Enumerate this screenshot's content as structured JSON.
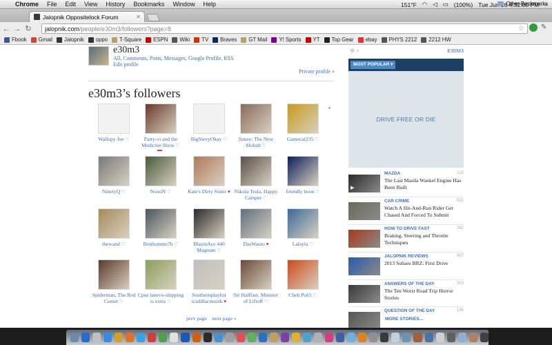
{
  "menubar": {
    "app": "Chrome",
    "items": [
      "File",
      "Edit",
      "View",
      "History",
      "Bookmarks",
      "Window",
      "Help"
    ],
    "temperature": "151°F",
    "battery": "(100%)",
    "clock": "Tue Jun 26  4:32:00 PM"
  },
  "tab": {
    "title": "Jalopnik Oppositelock Forum"
  },
  "address": {
    "host": "jalopnik.com",
    "path": "/people/e30m3/followers?page=8"
  },
  "bookmarks": {
    "items": [
      {
        "label": "Fbook",
        "color": "#3b5998"
      },
      {
        "label": "Gmail",
        "color": "#d14836"
      },
      {
        "label": "Jalopnik",
        "color": "#333333"
      },
      {
        "label": "oppo",
        "color": "#333333"
      },
      {
        "label": "T-Square",
        "color": "#b3a369"
      },
      {
        "label": "ESPN",
        "color": "#cc0000"
      },
      {
        "label": "Wiki",
        "color": "#555555"
      },
      {
        "label": "TV",
        "color": "#cc3300"
      },
      {
        "label": "Braves",
        "color": "#13274f"
      },
      {
        "label": "GT Mail",
        "color": "#b3a369"
      },
      {
        "label": "Y! Sports",
        "color": "#7b0099"
      },
      {
        "label": "YT",
        "color": "#cc0000"
      },
      {
        "label": "Top Gear",
        "color": "#222222"
      },
      {
        "label": "ebay",
        "color": "#e53238"
      },
      {
        "label": "PHYS 2212",
        "color": "#555555"
      },
      {
        "label": "2212 HW",
        "color": "#555555"
      }
    ],
    "other": "Other Bookmarks"
  },
  "profile": {
    "name": "e30m3",
    "links": "All, Comments, Posts, Messages, Google Profile, RSS",
    "edit": "Edit profile",
    "private": "Private profile »"
  },
  "followers_title": "e30m3’s followers",
  "followers": [
    {
      "name": "Wallopy Joe",
      "thumb": "noimg",
      "liked": false
    },
    {
      "name": "Party-vi and the Medicine Show",
      "thumb": "#6b3a2a",
      "liked": false
    },
    {
      "name": "BigStevyOkay",
      "thumb": "noimg",
      "liked": false
    },
    {
      "name": "Snuze: The New Slobalt",
      "thumb": "#8a6a5a",
      "liked": false
    },
    {
      "name": "Gamecat235",
      "thumb": "#c89a1a",
      "liked": false
    },
    {
      "name": "NinetyQ",
      "thumb": "#7a7a7a",
      "liked": false
    },
    {
      "name": "NoxoN",
      "thumb": "#4a5a3a",
      "liked": false
    },
    {
      "name": "Kate's Dirty Sister",
      "thumb": "#b07a5a",
      "liked": true
    },
    {
      "name": "Nikola Tesla, Happy Camper",
      "thumb": "#5a5048",
      "liked": false
    },
    {
      "name": "friendly boon",
      "thumb": "#0c1f5a",
      "liked": false
    },
    {
      "name": "thewand",
      "thumb": "#a88a5a",
      "liked": false
    },
    {
      "name": "Bonhomme7h",
      "thumb": "#4a5660",
      "liked": false
    },
    {
      "name": "BlazinAce 440 Magnum",
      "thumb": "#2a2a2a",
      "liked": false
    },
    {
      "name": "DasWauto",
      "thumb": "#607080",
      "liked": true
    },
    {
      "name": "Lalayla",
      "thumb": "#3a6a9a",
      "liked": false
    },
    {
      "name": "Spiderman, The Red Comet",
      "thumb": "#5a3a2a",
      "liked": false
    },
    {
      "name": "Cpus lanevo-shipping is extra",
      "thumb": "#8aa05a",
      "liked": false
    },
    {
      "name": "Southernplaylist icadillacmuzik",
      "thumb": "#c0c0c0",
      "liked": true
    },
    {
      "name": "Sir Halffast, Minister of Liftoff",
      "thumb": "#6a4a3a",
      "liked": false
    },
    {
      "name": "Cheh Poh'r",
      "thumb": "#d04a1a",
      "liked": false
    }
  ],
  "pager": {
    "prev": "prev page",
    "next": "next page »"
  },
  "sidebar": {
    "user": "E30M3",
    "most_popular": "MOST POPULAR",
    "ad_text": "DRIVE FREE OR DIE",
    "stories": [
      {
        "category": "MAZDA",
        "count": "215",
        "title": "The Last Mazda Wankel Engine Has Been Built",
        "thumb": "#2a2a2a"
      },
      {
        "category": "CAR CRIME",
        "count": "531",
        "title": "Watch A Hit-And-Run Rider Get Chased And Forced To Submit",
        "thumb": "#6a6a5a"
      },
      {
        "category": "HOW TO DRIVE FAST",
        "count": "282",
        "title": "Braking, Steering and Throttle Techniques",
        "thumb": "#a83a1a"
      },
      {
        "category": "JALOPNIK REVIEWS",
        "count": "997",
        "title": "2013 Subaru BRZ: First Drive",
        "thumb": "#2a5aaa"
      },
      {
        "category": "ANSWERS OF THE DAY",
        "count": "303",
        "title": "The Ten Worst Road Trip Horror Stories",
        "thumb": "#3a3a3a"
      },
      {
        "category": "QUESTION OF THE DAY",
        "count": "196",
        "title": "",
        "thumb": "#555555"
      }
    ],
    "more": "MORE STORIES..."
  }
}
